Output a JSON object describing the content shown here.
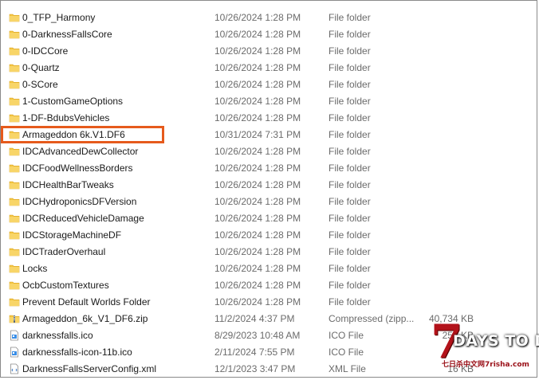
{
  "files": [
    {
      "name": "0_TFP_Harmony",
      "date": "10/26/2024 1:28 PM",
      "type": "File folder",
      "size": "",
      "icon": "folder-icon"
    },
    {
      "name": "0-DarknessFallsCore",
      "date": "10/26/2024 1:28 PM",
      "type": "File folder",
      "size": "",
      "icon": "folder-icon"
    },
    {
      "name": "0-IDCCore",
      "date": "10/26/2024 1:28 PM",
      "type": "File folder",
      "size": "",
      "icon": "folder-icon"
    },
    {
      "name": "0-Quartz",
      "date": "10/26/2024 1:28 PM",
      "type": "File folder",
      "size": "",
      "icon": "folder-icon"
    },
    {
      "name": "0-SCore",
      "date": "10/26/2024 1:28 PM",
      "type": "File folder",
      "size": "",
      "icon": "folder-icon"
    },
    {
      "name": "1-CustomGameOptions",
      "date": "10/26/2024 1:28 PM",
      "type": "File folder",
      "size": "",
      "icon": "folder-icon"
    },
    {
      "name": "1-DF-BdubsVehicles",
      "date": "10/26/2024 1:28 PM",
      "type": "File folder",
      "size": "",
      "icon": "folder-icon"
    },
    {
      "name": "Armageddon 6k.V1.DF6",
      "date": "10/31/2024 7:31 PM",
      "type": "File folder",
      "size": "",
      "icon": "folder-icon"
    },
    {
      "name": "IDCAdvancedDewCollector",
      "date": "10/26/2024 1:28 PM",
      "type": "File folder",
      "size": "",
      "icon": "folder-icon"
    },
    {
      "name": "IDCFoodWellnessBorders",
      "date": "10/26/2024 1:28 PM",
      "type": "File folder",
      "size": "",
      "icon": "folder-icon"
    },
    {
      "name": "IDCHealthBarTweaks",
      "date": "10/26/2024 1:28 PM",
      "type": "File folder",
      "size": "",
      "icon": "folder-icon"
    },
    {
      "name": "IDCHydroponicsDFVersion",
      "date": "10/26/2024 1:28 PM",
      "type": "File folder",
      "size": "",
      "icon": "folder-icon"
    },
    {
      "name": "IDCReducedVehicleDamage",
      "date": "10/26/2024 1:28 PM",
      "type": "File folder",
      "size": "",
      "icon": "folder-icon"
    },
    {
      "name": "IDCStorageMachineDF",
      "date": "10/26/2024 1:28 PM",
      "type": "File folder",
      "size": "",
      "icon": "folder-icon"
    },
    {
      "name": "IDCTraderOverhaul",
      "date": "10/26/2024 1:28 PM",
      "type": "File folder",
      "size": "",
      "icon": "folder-icon"
    },
    {
      "name": "Locks",
      "date": "10/26/2024 1:28 PM",
      "type": "File folder",
      "size": "",
      "icon": "folder-icon"
    },
    {
      "name": "OcbCustomTextures",
      "date": "10/26/2024 1:28 PM",
      "type": "File folder",
      "size": "",
      "icon": "folder-icon"
    },
    {
      "name": "Prevent Default Worlds Folder",
      "date": "10/26/2024 1:28 PM",
      "type": "File folder",
      "size": "",
      "icon": "folder-icon"
    },
    {
      "name": "Armageddon_6k_V1_DF6.zip",
      "date": "11/2/2024 4:37 PM",
      "type": "Compressed (zipp...",
      "size": "40,734 KB",
      "icon": "zip-folder-icon"
    },
    {
      "name": "darknessfalls.ico",
      "date": "8/29/2023 10:48 AM",
      "type": "ICO File",
      "size": "255 KB",
      "icon": "ico-file-icon"
    },
    {
      "name": "darknessfalls-icon-11b.ico",
      "date": "2/11/2024 7:55 PM",
      "type": "ICO File",
      "size": "",
      "icon": "ico-file-icon"
    },
    {
      "name": "DarknessFallsServerConfig.xml",
      "date": "12/1/2023 3:47 PM",
      "type": "XML File",
      "size": "16 KB",
      "icon": "xml-file-icon"
    }
  ],
  "highlighted_row": 7,
  "watermark": {
    "seven": "7",
    "text": "DAYS TO DIE",
    "sub": "七日杀中文网7risha.com"
  },
  "colors": {
    "folder": "#f4c542",
    "highlight": "#e65a1c",
    "watermark": "#b3121a"
  }
}
